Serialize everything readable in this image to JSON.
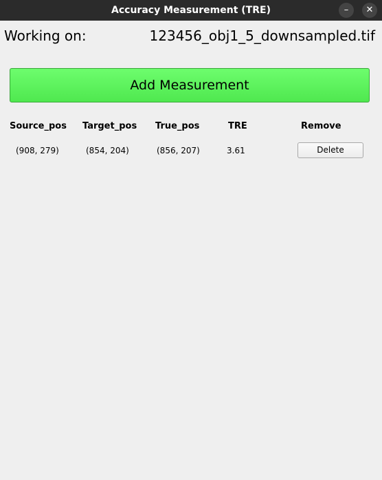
{
  "window": {
    "title": "Accuracy Measurement (TRE)",
    "minimize_glyph": "–",
    "close_glyph": "✕"
  },
  "working": {
    "label": "Working on:",
    "filename": "123456_obj1_5_downsampled.tif"
  },
  "add_button": {
    "label": "Add Measurement",
    "color": "#5cf55c"
  },
  "table": {
    "headers": [
      "Source_pos",
      "Target_pos",
      "True_pos",
      "TRE",
      "Remove"
    ],
    "rows": [
      {
        "source_pos": "(908, 279)",
        "target_pos": "(854, 204)",
        "true_pos": "(856, 207)",
        "tre": "3.61",
        "remove_label": "Delete"
      }
    ]
  }
}
